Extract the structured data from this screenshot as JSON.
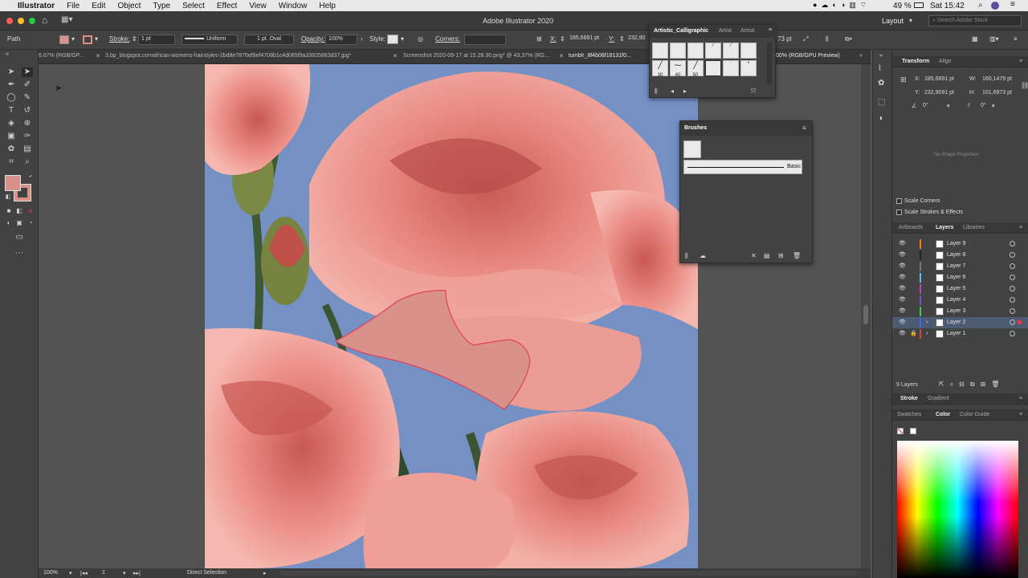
{
  "menubar": {
    "app": "Illustrator",
    "items": [
      "File",
      "Edit",
      "Object",
      "Type",
      "Select",
      "Effect",
      "View",
      "Window",
      "Help"
    ],
    "battery": "49 %",
    "time": "Sat 15:42"
  },
  "titlebar": {
    "title": "Adobe Illustrator 2020",
    "workspace": "Layout",
    "search_placeholder": "Search Adobe Stock"
  },
  "control": {
    "selection": "Path",
    "stroke_label": "Stroke:",
    "stroke_weight": "1 pt",
    "stroke_style": "Uniform",
    "brush": "1 pt. Oval",
    "opacity_label": "Opacity:",
    "opacity": "100%",
    "style_label": "Style:",
    "corners_label": "Corners:",
    "x_label": "X:",
    "x": "185,6691 pt",
    "y_label": "Y:",
    "y": "232,90",
    "w_partial": "73 pt"
  },
  "tabs": [
    {
      "label": "6,67% (RGB/GP..."
    },
    {
      "label": "3.bp_blogspot.comafrican-womens-hairstyles-2bd8e7876ef8ef4708b1c4d085f9a33925883d37.jpg*"
    },
    {
      "label": "Screenshot 2020-09-17 at 15.28.30.png* @ 43,37% (RG..."
    },
    {
      "label": "tumblr_8f4b06f16131f0..."
    },
    {
      "label": "00% (RGB/GPU Preview)"
    }
  ],
  "callig": {
    "tabs": [
      "Artistic_Calligraphic",
      "Artist",
      "Artisti"
    ],
    "sizes": [
      "30",
      "40",
      "50"
    ]
  },
  "brushes": {
    "title": "Brushes",
    "basic": "Basic"
  },
  "transform": {
    "tabs": [
      "Transform",
      "Align"
    ],
    "x_label": "X:",
    "x": "185,6691 pt",
    "w_label": "W:",
    "w": "160,1479 pt",
    "y_label": "Y:",
    "y": "232,9091 pt",
    "h_label": "H:",
    "h": "101,6973 pt",
    "angle": "0°",
    "shear": "0°",
    "empty": "No Shape Properties",
    "scale_corners": "Scale Corners",
    "scale_strokes": "Scale Strokes & Effects"
  },
  "layers_panel": {
    "tabs": [
      "Artboards",
      "Layers",
      "Libraries"
    ],
    "count": "9 Layers",
    "layers": [
      {
        "name": "Layer 9",
        "color": "#ff7a00"
      },
      {
        "name": "Layer 8",
        "color": "#222222"
      },
      {
        "name": "Layer 7",
        "color": "#777777"
      },
      {
        "name": "Layer 6",
        "color": "#4fc3f7"
      },
      {
        "name": "Layer 5",
        "color": "#c040c0"
      },
      {
        "name": "Layer 4",
        "color": "#7a50e0"
      },
      {
        "name": "Layer 3",
        "color": "#40d040"
      },
      {
        "name": "Layer 2",
        "color": "#4060ff"
      },
      {
        "name": "Layer 1",
        "color": "#e04040"
      }
    ]
  },
  "stroke_panel": {
    "tabs": [
      "Stroke",
      "Gradient"
    ]
  },
  "color_panel": {
    "tabs": [
      "Swatches",
      "Color",
      "Color Guide"
    ]
  },
  "status": {
    "zoom": "100%",
    "artboard": "1",
    "tool": "Direct Selection"
  },
  "colors": {
    "fill": "#d8928a",
    "shape": "#d9918c",
    "shape_stroke": "#e0405a"
  }
}
